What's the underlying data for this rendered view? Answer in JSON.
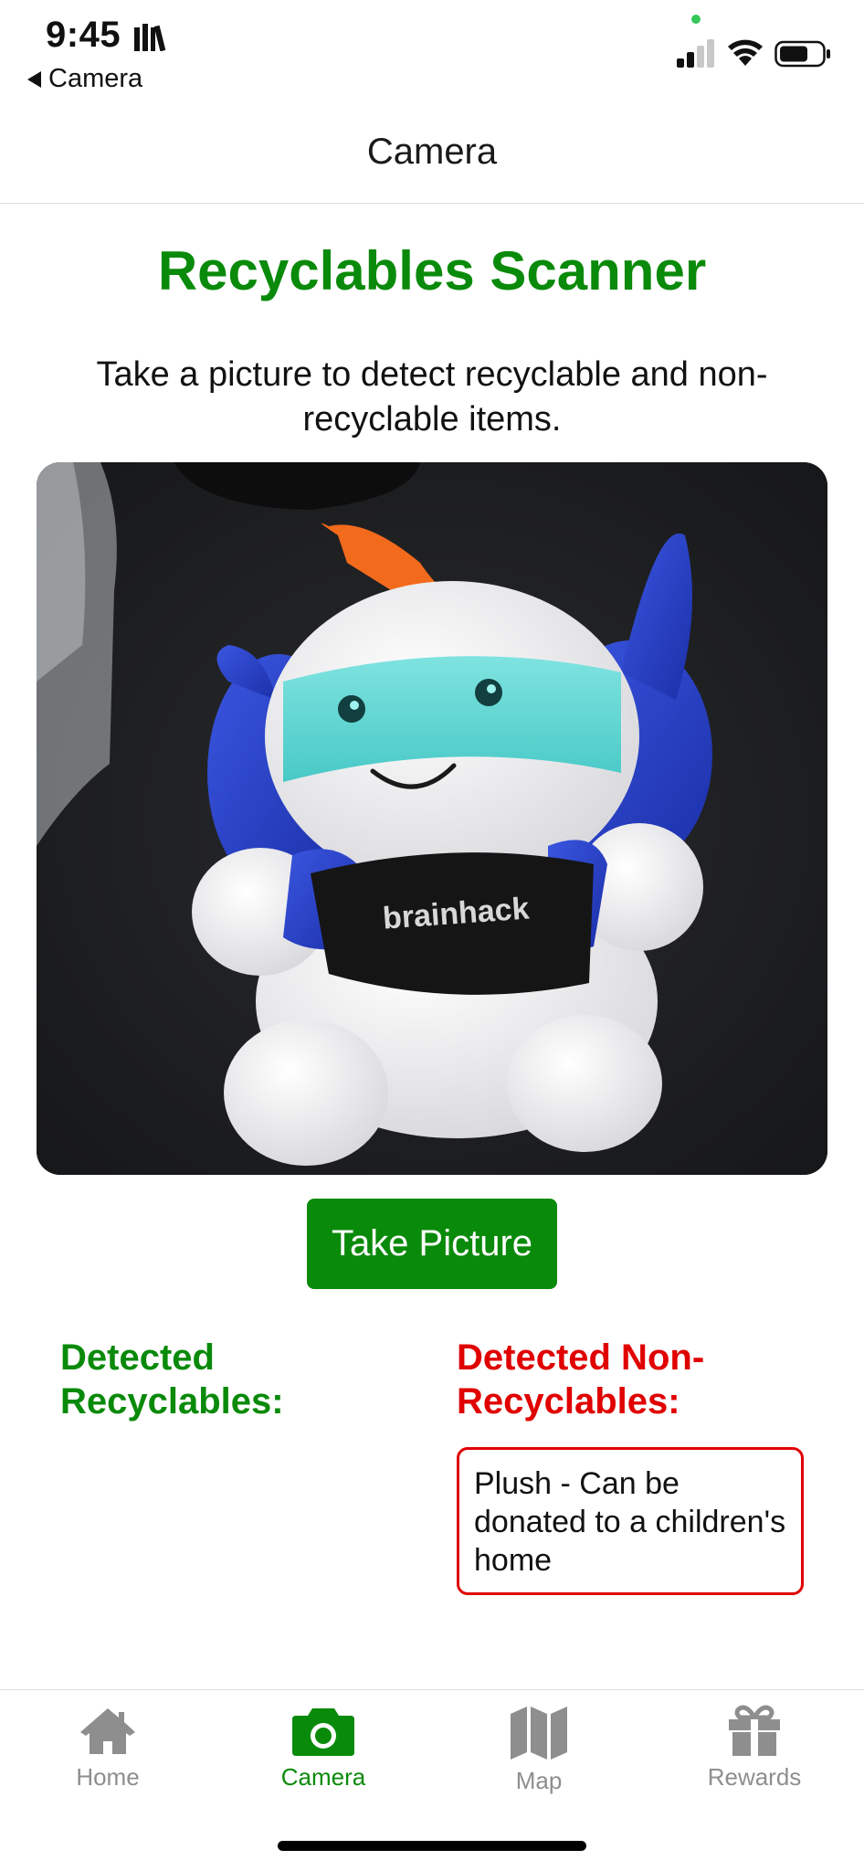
{
  "status_bar": {
    "time": "9:45",
    "back_label": "Camera",
    "icons": [
      "library-icon",
      "cellular-signal-icon",
      "wifi-icon",
      "battery-icon"
    ]
  },
  "nav": {
    "title": "Camera"
  },
  "main": {
    "title": "Recyclables Scanner",
    "instructions": "Take a picture to detect recyclable and non-recyclable items.",
    "photo_icon": "captured-photo-plush-toy",
    "take_picture_label": "Take Picture"
  },
  "results": {
    "recyclables_title": "Detected Recyclables:",
    "recyclables_items": [],
    "non_recyclables_title": "Detected Non-Recyclables:",
    "non_recyclables_items": [
      "Plush - Can be donated to a children's home"
    ]
  },
  "tab_bar": {
    "tabs": [
      {
        "label": "Home",
        "icon": "home-icon",
        "active": false
      },
      {
        "label": "Camera",
        "icon": "camera-icon",
        "active": true
      },
      {
        "label": "Map",
        "icon": "map-icon",
        "active": false
      },
      {
        "label": "Rewards",
        "icon": "gift-icon",
        "active": false
      }
    ]
  },
  "colors": {
    "accent_green": "#0a8a0a",
    "alert_red": "#e00000",
    "inactive_gray": "#8e8e8e"
  }
}
